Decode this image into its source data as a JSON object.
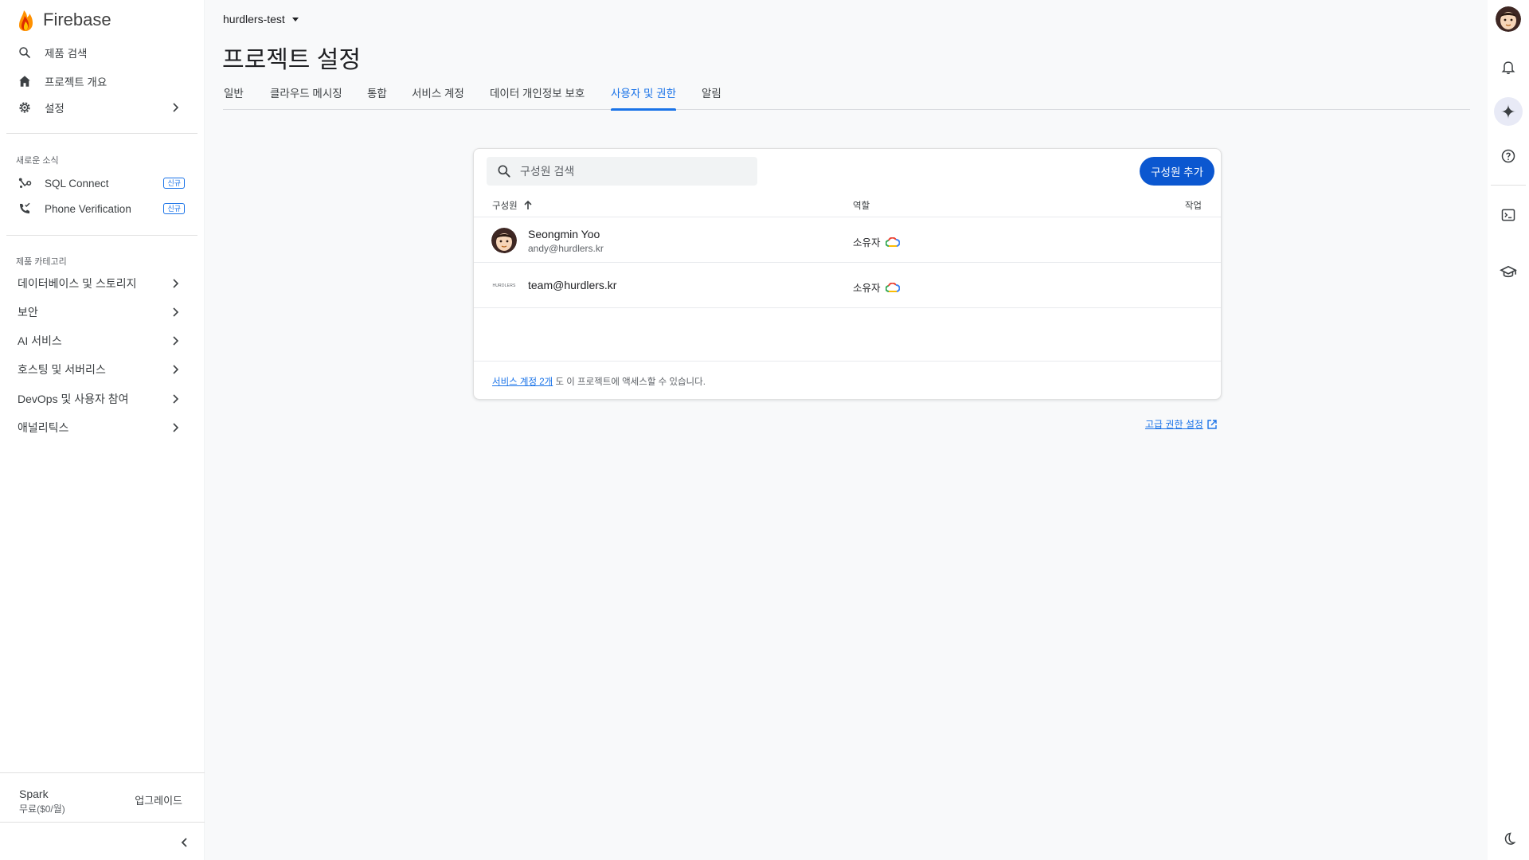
{
  "brand": {
    "name": "Firebase"
  },
  "nav": {
    "search": "제품 검색",
    "overview": "프로젝트 개요",
    "settings": "설정"
  },
  "whats_new": {
    "label": "새로운 소식",
    "items": [
      {
        "label": "SQL Connect",
        "tag": "신규"
      },
      {
        "label": "Phone Verification",
        "tag": "신규"
      }
    ]
  },
  "categories": {
    "label": "제품 카테고리",
    "items": [
      {
        "label": "데이터베이스 및 스토리지"
      },
      {
        "label": "보안"
      },
      {
        "label": "AI 서비스"
      },
      {
        "label": "호스팅 및 서버리스"
      },
      {
        "label": "DevOps 및 사용자 참여"
      },
      {
        "label": "애널리틱스"
      }
    ]
  },
  "plan": {
    "name": "Spark",
    "price": "무료($0/월)",
    "upgrade": "업그레이드"
  },
  "project": {
    "name": "hurdlers-test"
  },
  "page": {
    "title": "프로젝트 설정"
  },
  "tabs": [
    {
      "label": "일반"
    },
    {
      "label": "클라우드 메시징"
    },
    {
      "label": "통합"
    },
    {
      "label": "서비스 계정"
    },
    {
      "label": "데이터 개인정보 보호"
    },
    {
      "label": "사용자 및 권한",
      "active": true
    },
    {
      "label": "알림"
    }
  ],
  "members": {
    "search_placeholder": "구성원 검색",
    "add_button": "구성원 추가",
    "columns": {
      "member": "구성원",
      "role": "역할",
      "actions": "작업"
    },
    "rows": [
      {
        "name": "Seongmin Yoo",
        "email": "andy@hurdlers.kr",
        "role": "소유자"
      },
      {
        "name": "team@hurdlers.kr",
        "email": "",
        "role": "소유자",
        "logo_text": "HURDLERS"
      }
    ],
    "footer_link": "서비스 계정 2개",
    "footer_text": " 도 이 프로젝트에 액세스할 수 있습니다."
  },
  "advanced_link": "고급 권한 설정",
  "colors": {
    "accent": "#1a73e8",
    "primary_button": "#0b57d0",
    "firebase_orange": "#ff9100"
  }
}
